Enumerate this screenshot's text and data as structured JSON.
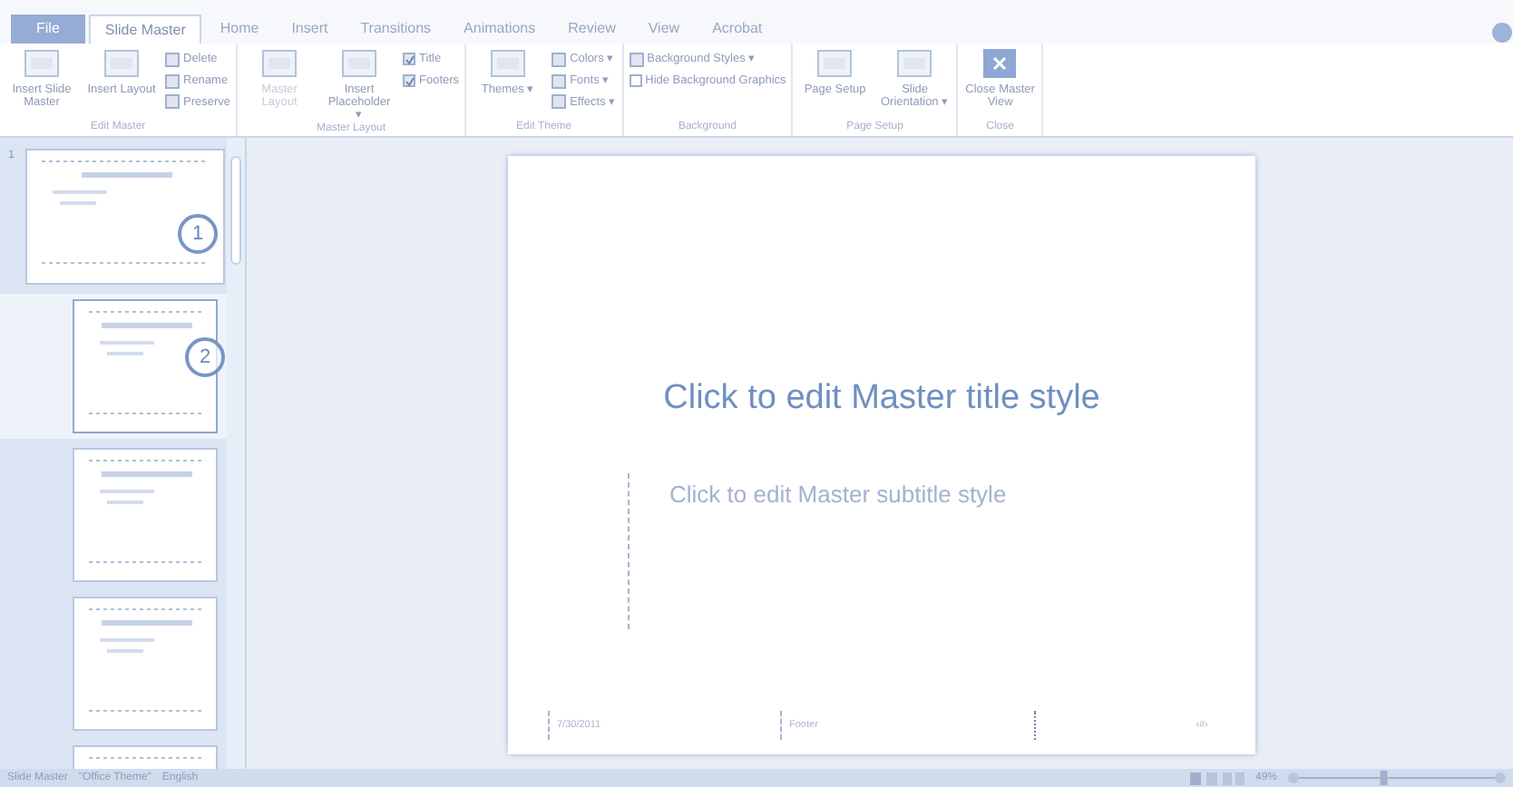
{
  "tabs": [
    {
      "label": "File",
      "kind": "file",
      "selected": false
    },
    {
      "label": "Slide Master",
      "kind": "tab",
      "selected": true
    },
    {
      "label": "Home",
      "kind": "tab",
      "selected": false
    },
    {
      "label": "Insert",
      "kind": "tab",
      "selected": false
    },
    {
      "label": "Transitions",
      "kind": "tab",
      "selected": false
    },
    {
      "label": "Animations",
      "kind": "tab",
      "selected": false
    },
    {
      "label": "Review",
      "kind": "tab",
      "selected": false
    },
    {
      "label": "View",
      "kind": "tab",
      "selected": false
    },
    {
      "label": "Acrobat",
      "kind": "tab",
      "selected": false
    }
  ],
  "ribbon_groups": [
    {
      "label": "Edit Master",
      "items": [
        {
          "kind": "large",
          "label": "Insert Slide Master"
        },
        {
          "kind": "large",
          "label": "Insert Layout"
        },
        {
          "kind": "stack",
          "items": [
            {
              "label": "Delete"
            },
            {
              "label": "Rename"
            },
            {
              "label": "Preserve"
            }
          ]
        }
      ]
    },
    {
      "label": "Master Layout",
      "items": [
        {
          "kind": "large",
          "label": "Master Layout",
          "disabled": true
        },
        {
          "kind": "large",
          "label": "Insert Placeholder ▾"
        },
        {
          "kind": "checks",
          "items": [
            {
              "label": "Title",
              "checked": true
            },
            {
              "label": "Footers",
              "checked": true
            }
          ]
        }
      ]
    },
    {
      "label": "Edit Theme",
      "items": [
        {
          "kind": "large",
          "label": "Themes ▾"
        },
        {
          "kind": "stack",
          "items": [
            {
              "label": "Colors ▾"
            },
            {
              "label": "Fonts ▾"
            },
            {
              "label": "Effects ▾"
            }
          ]
        }
      ]
    },
    {
      "label": "Background",
      "items": [
        {
          "kind": "checks",
          "items": [
            {
              "label": "Background Styles ▾",
              "kind": "menu"
            },
            {
              "label": "Hide Background Graphics",
              "checked": false
            }
          ]
        }
      ]
    },
    {
      "label": "Page Setup",
      "items": [
        {
          "kind": "large",
          "label": "Page Setup"
        },
        {
          "kind": "large",
          "label": "Slide Orientation ▾"
        }
      ]
    },
    {
      "label": "Close",
      "items": [
        {
          "kind": "close",
          "label": "Close Master View"
        }
      ]
    }
  ],
  "thumbnails": [
    {
      "number": "1",
      "callout": "1",
      "selected": false
    },
    {
      "callout": "2",
      "selected": true
    },
    {
      "selected": false
    },
    {
      "selected": false
    },
    {
      "selected": false
    }
  ],
  "slide": {
    "title": "Click to edit Master title style",
    "subtitle": "Click to edit Master subtitle style",
    "date": "7/30/2011",
    "footer": "Footer",
    "page_number": "‹#›"
  },
  "status_bar": {
    "view": "Slide Master",
    "theme": "\"Office Theme\"",
    "language": "English",
    "zoom": "49%",
    "zoom_slider": {
      "level": 0.45
    }
  }
}
